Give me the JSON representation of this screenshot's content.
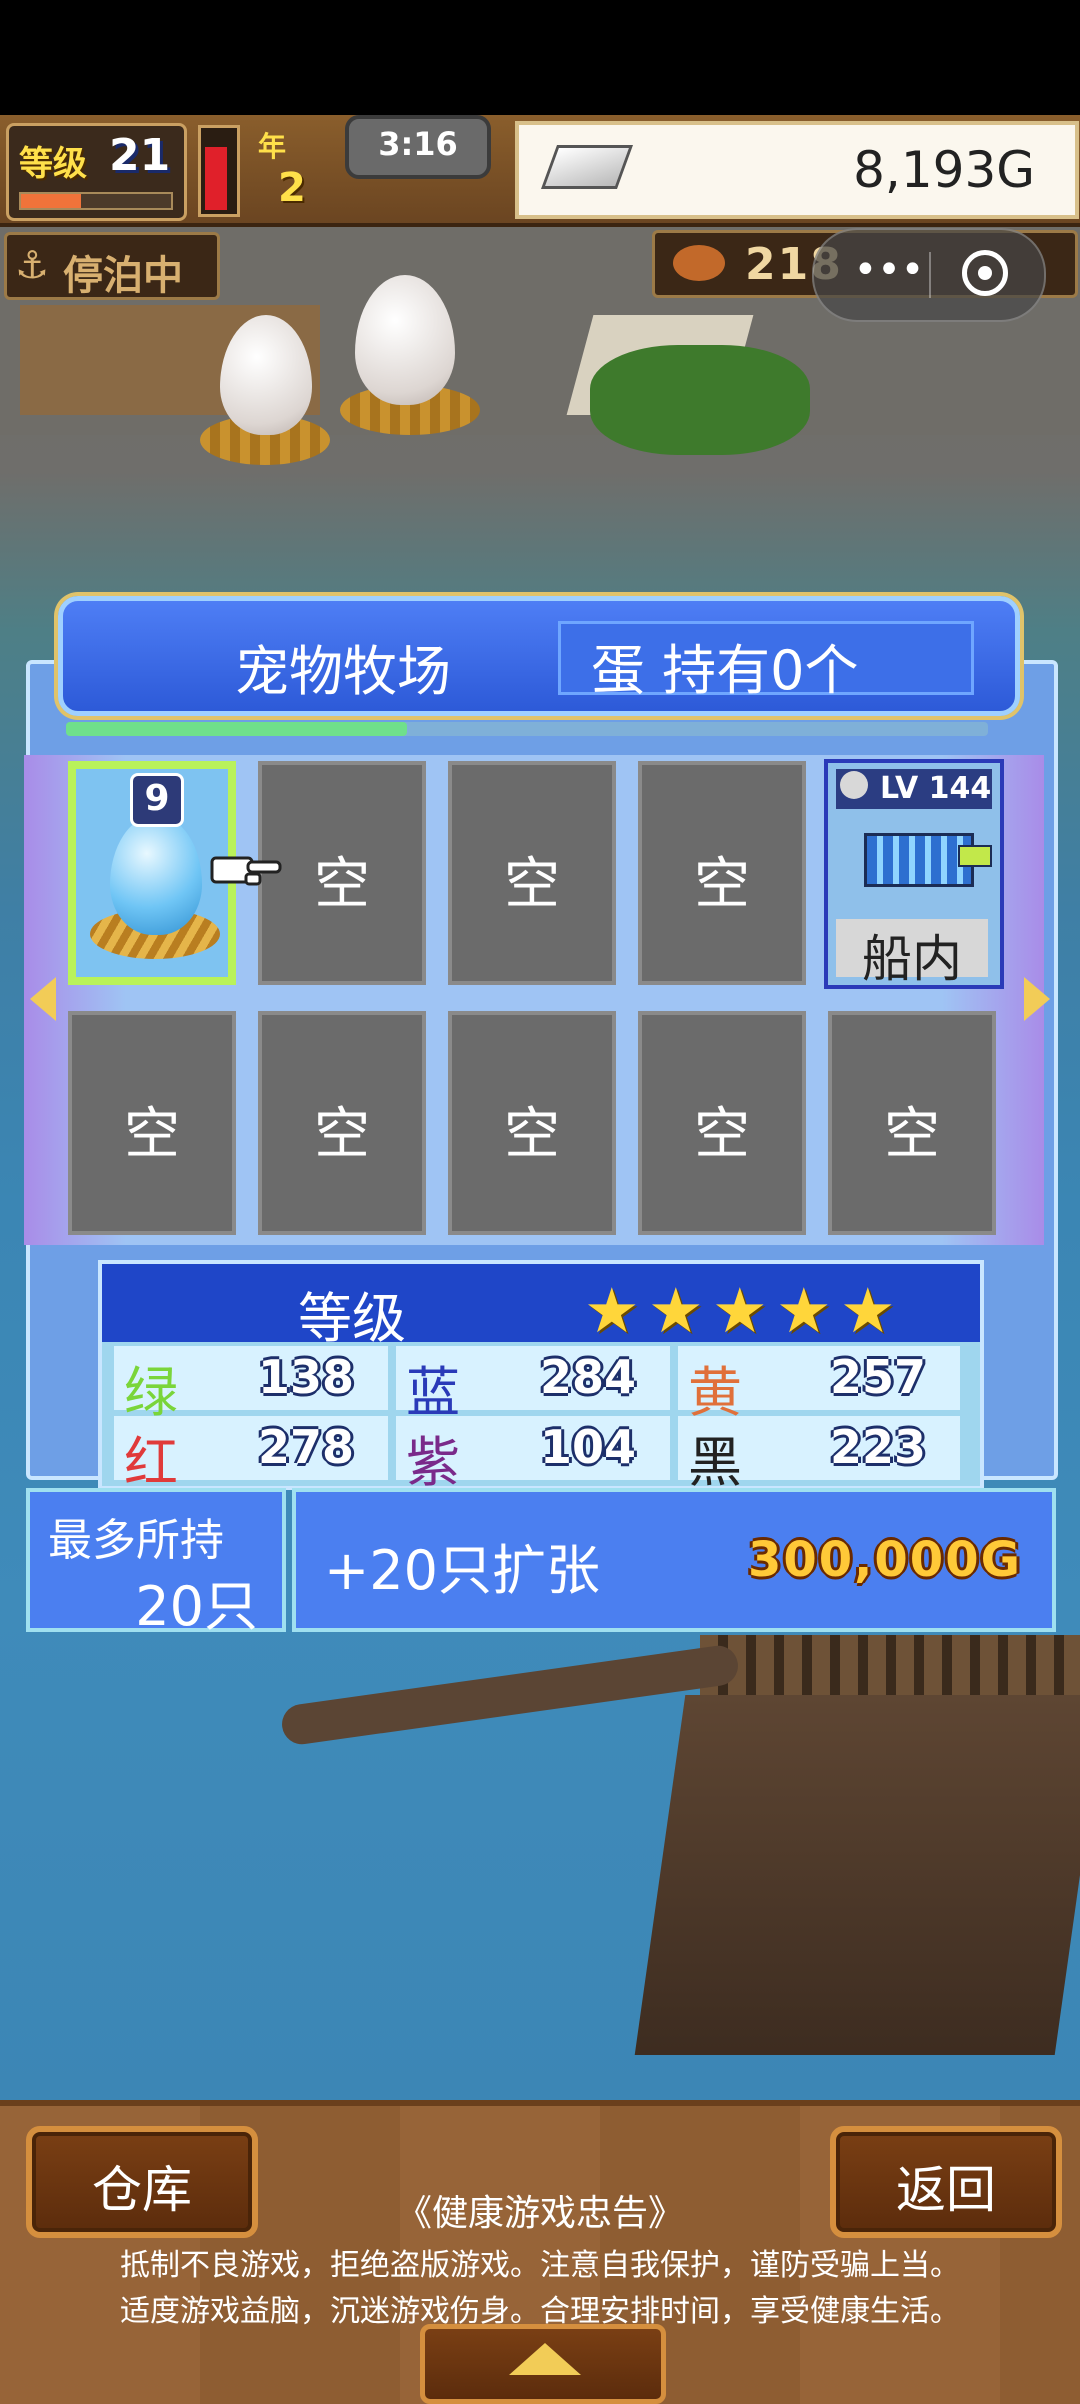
{
  "hud": {
    "level_label": "等级",
    "level_value": "21",
    "level_progress": 0.4,
    "stamina_fill": 0.85,
    "year_label": "年",
    "year_value": "2",
    "time": "3:16",
    "money": "8,193G"
  },
  "status": {
    "anchored_label": "停泊中",
    "resource_value": "218"
  },
  "capsule": {
    "more_icon": "more-dots-icon",
    "close_icon": "target-close-icon"
  },
  "panel": {
    "title": "宠物牧场",
    "egg_count": "蛋 持有0个",
    "progress": 0.37,
    "slots": [
      {
        "type": "egg",
        "number": "9"
      },
      {
        "type": "empty",
        "label": "空"
      },
      {
        "type": "empty",
        "label": "空"
      },
      {
        "type": "empty",
        "label": "空"
      },
      {
        "type": "ship",
        "level": "LV 144",
        "label": "船内"
      },
      {
        "type": "empty",
        "label": "空"
      },
      {
        "type": "empty",
        "label": "空"
      },
      {
        "type": "empty",
        "label": "空"
      },
      {
        "type": "empty",
        "label": "空"
      },
      {
        "type": "empty",
        "label": "空"
      }
    ]
  },
  "stats": {
    "title": "等级",
    "stars": 5,
    "items": [
      {
        "name": "绿",
        "value": "138",
        "color": "#7ad53a"
      },
      {
        "name": "蓝",
        "value": "284",
        "color": "#2a3ab8"
      },
      {
        "name": "黄",
        "value": "257",
        "color": "#e0703a"
      },
      {
        "name": "红",
        "value": "278",
        "color": "#e03a3a"
      },
      {
        "name": "紫",
        "value": "104",
        "color": "#7a2a8a"
      },
      {
        "name": "黑",
        "value": "223",
        "color": "#222222"
      }
    ]
  },
  "capacity": {
    "label": "最多所持",
    "value": "20只"
  },
  "expand": {
    "label": "+20只扩张",
    "price": "300,000G"
  },
  "bottom": {
    "warehouse_label": "仓库",
    "back_label": "返回",
    "notice_title": "《健康游戏忠告》",
    "notice_line1": "抵制不良游戏，拒绝盗版游戏。注意自我保护，谨防受骗上当。",
    "notice_line2": "适度游戏益脑，沉迷游戏伤身。合理安排时间，享受健康生活。"
  }
}
